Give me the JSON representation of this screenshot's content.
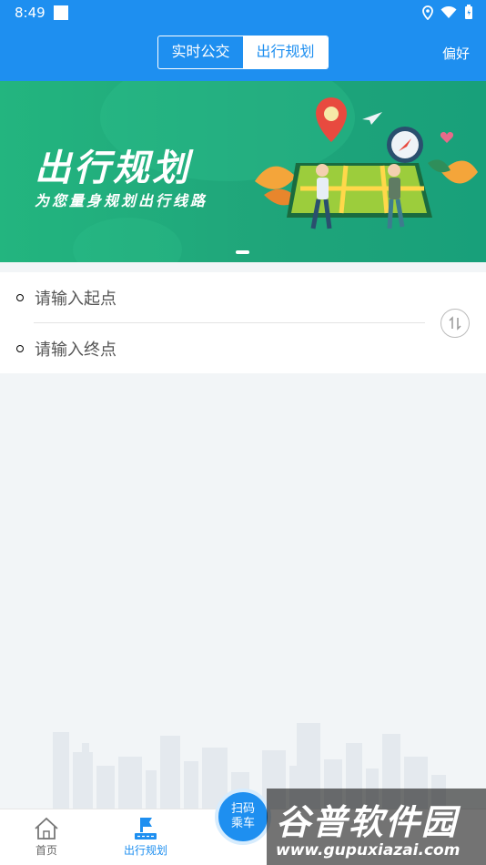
{
  "status_bar": {
    "time": "8:49"
  },
  "header": {
    "tabs": [
      {
        "label": "实时公交",
        "active": false
      },
      {
        "label": "出行规划",
        "active": true
      }
    ],
    "preference_label": "偏好"
  },
  "banner": {
    "title": "出行规划",
    "subtitle": "为您量身规划出行线路"
  },
  "route": {
    "start_placeholder": "请输入起点",
    "end_placeholder": "请输入终点"
  },
  "bottom_nav": {
    "items": [
      {
        "label": "首页",
        "icon": "home-icon",
        "active": false
      },
      {
        "label": "出行规划",
        "icon": "flag-icon",
        "active": true
      }
    ],
    "scan_button": {
      "line1": "扫码",
      "line2": "乘车"
    }
  },
  "watermark": {
    "title": "谷普软件园",
    "url": "www.gupuxiazai.com"
  },
  "colors": {
    "primary": "#1e8ff0",
    "banner_green": "#1fa57a",
    "start_dot": "#2dbe4f",
    "end_dot": "#e84c3d"
  }
}
